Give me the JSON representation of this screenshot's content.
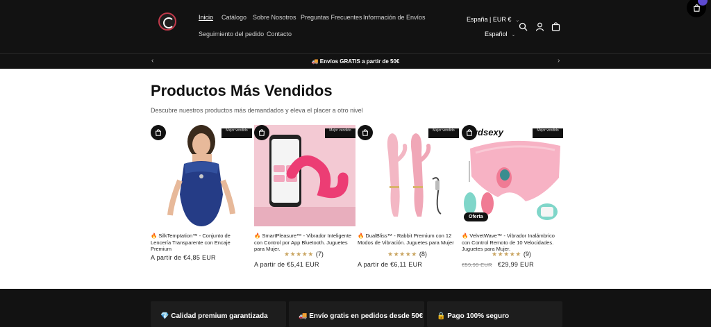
{
  "nav": {
    "row1": [
      "Inicio",
      "Catálogo",
      "Sobre Nosotros",
      "Preguntas Frecuentes",
      "Información de Envíos"
    ],
    "row2": [
      "Seguimiento del pedido",
      "Contacto"
    ]
  },
  "locale": {
    "country": "España | EUR €",
    "language": "Español"
  },
  "announcement": "🚚 Envíos GRATIS a partir de 50€",
  "section": {
    "title": "Productos Más Vendidos",
    "subtitle": "Descubre nuestros productos más demandados y eleva el placer a otro nivel"
  },
  "products": [
    {
      "title": "🔥 SilkTemptation™ - Conjunto de Lencería Transparente con Encaje Premium",
      "badge": "Mejor vendido",
      "price": "A partir de €4,85 EUR"
    },
    {
      "title": "🔥 SmartPleasure™ - Vibrador Inteligente con Control por App Bluetooth. Juguetes para Mujer.",
      "badge": "Mejor vendido",
      "rating": "★★★★★",
      "reviews": "(7)",
      "price": "A partir de €5,41 EUR"
    },
    {
      "title": "🔥 DualBliss™ - Rabbit Premium con 12 Modos de Vibración. Juguetes para Mujer",
      "badge": "Mejor vendido",
      "rating": "★★★★★",
      "reviews": "(8)",
      "price": "A partir de €6,11 EUR"
    },
    {
      "title": "🔥 VelvetWave™ - Vibrador Inalámbrico con Control Remoto de 10 Velocidades. Juguetes para Mujer.",
      "badge": "Mejor vendido",
      "offer": "Oferta",
      "brand": "rdsexy",
      "rating": "★★★★★",
      "reviews": "(9)",
      "price_compare": "€59,99 EUR",
      "price": "€29,99 EUR"
    }
  ],
  "features": [
    "💎 Calidad premium garantizada",
    "🚚 Envío gratis en pedidos desde 50€",
    "🔒 Pago 100% seguro"
  ],
  "colors": {
    "header_bg": "#121212",
    "stars": "#c8a35e",
    "cart_dot": "#5d4ad1"
  }
}
